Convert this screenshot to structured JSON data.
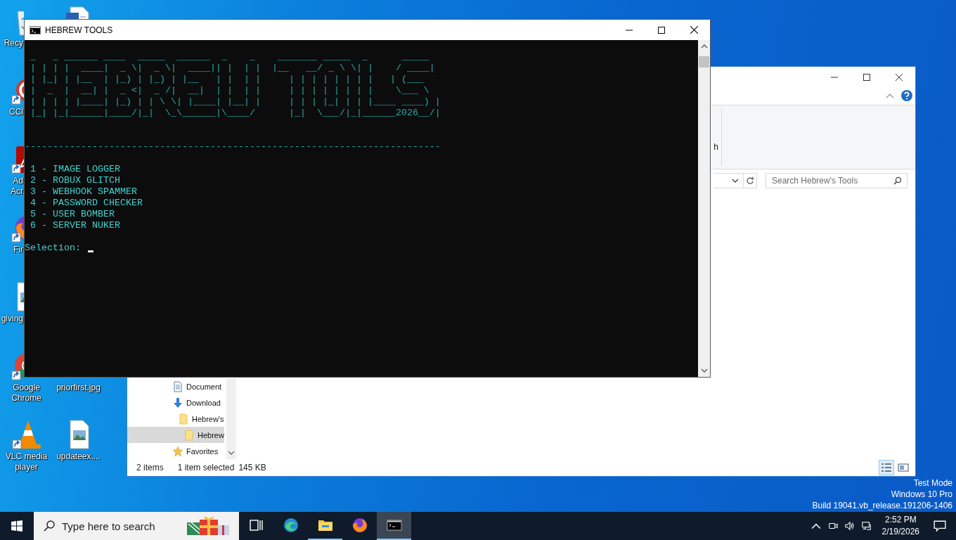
{
  "desktop": {
    "icons": [
      {
        "kind": "recycle-bin",
        "lines": [
          "Recy"
        ]
      },
      {
        "kind": "document"
      },
      {
        "kind": "ccleaner",
        "lines": [
          "CCl"
        ],
        "shortcut": true
      },
      {
        "kind": "acrobat",
        "lines": [
          "Ad",
          "Acr"
        ],
        "shortcut": true
      },
      {
        "kind": "firefox",
        "lines": [
          "Fir"
        ],
        "shortcut": true
      },
      {
        "kind": "image-file",
        "lines": [
          "giving"
        ]
      },
      {
        "kind": "chrome",
        "lines": [
          "Google",
          "Chrome"
        ],
        "shortcut": true
      },
      {
        "lines": [
          "priorfirst.jpg"
        ]
      },
      {
        "kind": "vlc",
        "lines": [
          "VLC media",
          "player"
        ],
        "shortcut": true
      },
      {
        "kind": "image-file",
        "lines": [
          "updateex...."
        ]
      }
    ],
    "system_info": [
      "Test Mode",
      "Windows 10 Pro",
      "Build 19041.vb_release.191206-1406"
    ]
  },
  "explorer": {
    "ribbon_text": "h",
    "search": {
      "placeholder": "Search Hebrew's Tools"
    },
    "nav": [
      {
        "label": "Document",
        "kind": "documents",
        "selected": false
      },
      {
        "label": "Download",
        "kind": "downloads",
        "selected": false,
        "children": [
          {
            "label": "Hebrew's",
            "kind": "folder",
            "selected": false,
            "children": [
              {
                "label": "Hebrew",
                "kind": "folder",
                "selected": true
              }
            ]
          }
        ]
      },
      {
        "label": "Favorites",
        "kind": "favorites",
        "selected": false
      }
    ],
    "status": [
      "2 items",
      "1 item selected",
      "145 KB"
    ]
  },
  "console": {
    "title": "HEBREW TOOLS",
    "banner": [
      "_   _ ______ ____  _____  ______  _    _    _______ _____  _      _____ ",
      "| | | |  ____|  _ \\|  _ \\|  ____|| |  | |  |__   __/ _ \\ \\| |    / ____|",
      "| |_| | |__  | |_) | |_) | |__   | |  | |     | | | | | | | |   | (___  ",
      "|  _  |  __| |  _ <|  _ /|  __|  | |  | |     | | | | | | | |    \\___ \\ ",
      "| | | | |____| |_) | | \\ \\| |____| |__| |     | | | |_| | | |____ ____) |",
      "|_| |_|______|____/|_|  \\_\\______|\\____/      |_|  \\___/|_|______2026__/|"
    ],
    "divider": "--------------------------------------------------------------------------",
    "menu": [
      "1 - IMAGE LOGGER",
      "2 - ROBUX GLITCH",
      "3 - WEBHOOK SPAMMER",
      "4 - PASSWORD CHECKER",
      "5 - USER BOMBER",
      "6 - SERVER NUKER"
    ],
    "prompt": "Selection:"
  },
  "taskbar": {
    "search_placeholder": "Type here to search",
    "apps": [
      {
        "kind": "task-view",
        "running": false,
        "active": false
      },
      {
        "kind": "edge",
        "running": false,
        "active": false
      },
      {
        "kind": "file-explorer",
        "running": true,
        "active": false
      },
      {
        "kind": "firefox",
        "running": false,
        "active": false
      },
      {
        "kind": "terminal",
        "running": true,
        "active": true
      }
    ],
    "time": "2:52 PM",
    "date": "2/19/2026"
  }
}
